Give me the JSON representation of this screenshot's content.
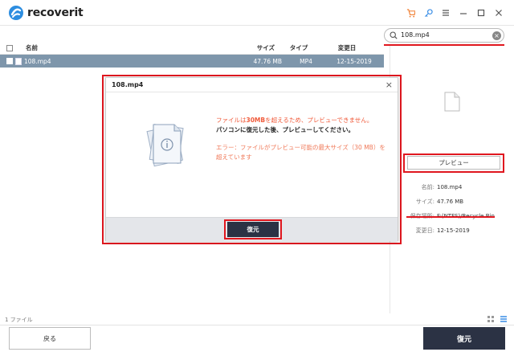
{
  "app": {
    "name": "recoverit"
  },
  "search": {
    "value": "108.mp4"
  },
  "table": {
    "headers": {
      "name": "名前",
      "size": "サイズ",
      "type": "タイプ",
      "date": "変更日"
    },
    "rows": [
      {
        "name": "108.mp4",
        "size": "47.76 MB",
        "type": "MP4",
        "date": "12-15-2019"
      }
    ]
  },
  "preview_panel": {
    "preview_button": "プレビュー",
    "meta": [
      {
        "key": "名前:",
        "value": "108.mp4"
      },
      {
        "key": "サイズ:",
        "value": "47.76 MB"
      },
      {
        "key": "保存場所:",
        "value": "F:(NTFS)/Recycle Bin"
      },
      {
        "key": "変更日:",
        "value": "12-15-2019"
      }
    ]
  },
  "status": {
    "count": "1 ファイル"
  },
  "footer": {
    "back": "戻る",
    "recover": "復元"
  },
  "modal": {
    "title": "108.mp4",
    "msg_pre": "ファイルは",
    "msg_limit": "30MB",
    "msg_post": "を超えるため、プレビューできません。",
    "msg_line2": "パソコンに復元した後、プレビューしてください。",
    "error": "エラー：ファイルがプレビュー可能の最大サイズ（30 MB）を超えています",
    "recover_button": "復元"
  },
  "colors": {
    "accent_red": "#e0171f",
    "dark_button": "#2b3244",
    "selected_row": "#7e96ab",
    "warning": "#f05a3a"
  }
}
